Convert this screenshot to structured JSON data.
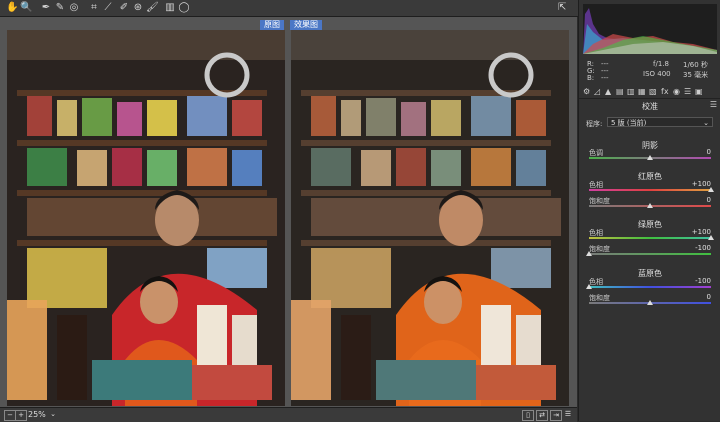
{
  "toolbar": {
    "tools": [
      "hand-icon",
      "zoom-icon",
      "white-balance-icon",
      "color-sampler-icon",
      "targeted-adjust-icon",
      "crop-icon",
      "straighten-icon",
      "spot-removal-icon",
      "red-eye-icon",
      "brush-icon",
      "graduated-filter-icon",
      "radial-filter-icon"
    ],
    "exit_icon": "exit-fullscreen-icon"
  },
  "views": {
    "before_label": "原图",
    "after_label": "效果图"
  },
  "status": {
    "zoom": "25%"
  },
  "info": {
    "r_label": "R:",
    "g_label": "G:",
    "b_label": "B:",
    "r_value": "---",
    "g_value": "---",
    "b_value": "---",
    "aperture": "f/1.8",
    "shutter": "1/60 秒",
    "iso": "ISO 400",
    "focal": "35 毫米"
  },
  "panel": {
    "section": "校准",
    "process_label": "程序:",
    "process_value": "5 版 (当前)",
    "shadow_title": "阴影",
    "shadow_tint_label": "色调",
    "shadow_tint_value": "0",
    "red_title": "红原色",
    "red_hue_label": "色相",
    "red_hue_value": "+100",
    "red_sat_label": "饱和度",
    "red_sat_value": "0",
    "green_title": "绿原色",
    "green_hue_label": "色相",
    "green_hue_value": "+100",
    "green_sat_label": "饱和度",
    "green_sat_value": "-100",
    "blue_title": "蓝原色",
    "blue_hue_label": "色相",
    "blue_hue_value": "-100",
    "blue_sat_label": "饱和度",
    "blue_sat_value": "0"
  },
  "colors": {
    "accent": "#4b77c6",
    "panel_bg": "#323232",
    "canvas_bg": "#555555"
  }
}
